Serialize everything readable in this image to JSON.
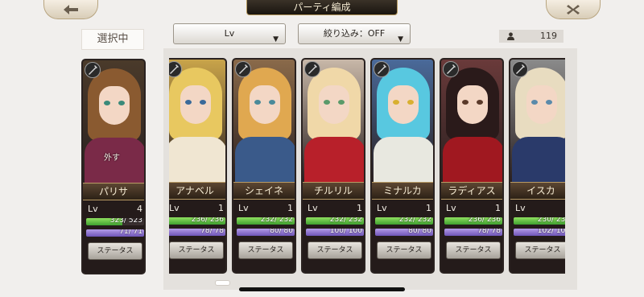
{
  "header": {
    "title": "パーティ編成",
    "back_icon": "back-arrow-icon",
    "close_icon": "close-icon"
  },
  "selected_label": "選択中",
  "sort": {
    "value": "Lv"
  },
  "filter": {
    "value": "絞り込み：OFF"
  },
  "unit_count": "119",
  "status_button_label": "ステータス",
  "selected_character": {
    "name": "パリサ",
    "lv_label": "Lv",
    "lv": "4",
    "hp": "323/ 523",
    "hp_ratio": 0.62,
    "mp": "71/ 71",
    "mp_ratio": 1.0,
    "remove_label": "外す",
    "palette": {
      "hair": "#8a5a30",
      "body": "#7a2a48",
      "bg": "#4a3a2a",
      "eye": "#3a8a7a"
    }
  },
  "characters": [
    {
      "name": "アナベル",
      "lv_label": "Lv",
      "lv": "1",
      "hp": "236/ 236",
      "hp_ratio": 1.0,
      "mp": "78/ 78",
      "mp_ratio": 1.0,
      "palette": {
        "hair": "#e8c860",
        "body": "#f0e6d2",
        "bg": "#c9a44a",
        "eye": "#3a6a9a"
      }
    },
    {
      "name": "シェイネ",
      "lv_label": "Lv",
      "lv": "1",
      "hp": "232/ 232",
      "hp_ratio": 1.0,
      "mp": "80/ 80",
      "mp_ratio": 1.0,
      "palette": {
        "hair": "#e0a850",
        "body": "#3a5a8a",
        "bg": "#8a6a4a",
        "eye": "#4a8a9a"
      }
    },
    {
      "name": "チルリル",
      "lv_label": "Lv",
      "lv": "1",
      "hp": "232/ 232",
      "hp_ratio": 1.0,
      "mp": "100/ 100",
      "mp_ratio": 1.0,
      "palette": {
        "hair": "#f0d8a8",
        "body": "#b8202a",
        "bg": "#c8b8a8",
        "eye": "#5a9a6a"
      }
    },
    {
      "name": "ミナルカ",
      "lv_label": "Lv",
      "lv": "1",
      "hp": "232/ 232",
      "hp_ratio": 1.0,
      "mp": "80/ 80",
      "mp_ratio": 1.0,
      "palette": {
        "hair": "#58c8e0",
        "body": "#e8e8e0",
        "bg": "#4a6a9a",
        "eye": "#d8b030"
      }
    },
    {
      "name": "ラディアス",
      "lv_label": "Lv",
      "lv": "1",
      "hp": "236/ 236",
      "hp_ratio": 1.0,
      "mp": "78/ 78",
      "mp_ratio": 1.0,
      "palette": {
        "hair": "#2a1a1a",
        "body": "#a01820",
        "bg": "#6a3a3a",
        "eye": "#5a3a2a"
      }
    },
    {
      "name": "イスカ",
      "lv_label": "Lv",
      "lv": "1",
      "hp": "230/ 230",
      "hp_ratio": 1.0,
      "mp": "102/ 102",
      "mp_ratio": 1.0,
      "palette": {
        "hair": "#e8dcc0",
        "body": "#2a3a6a",
        "bg": "#8a8a8a",
        "eye": "#5a8aaa"
      }
    }
  ]
}
